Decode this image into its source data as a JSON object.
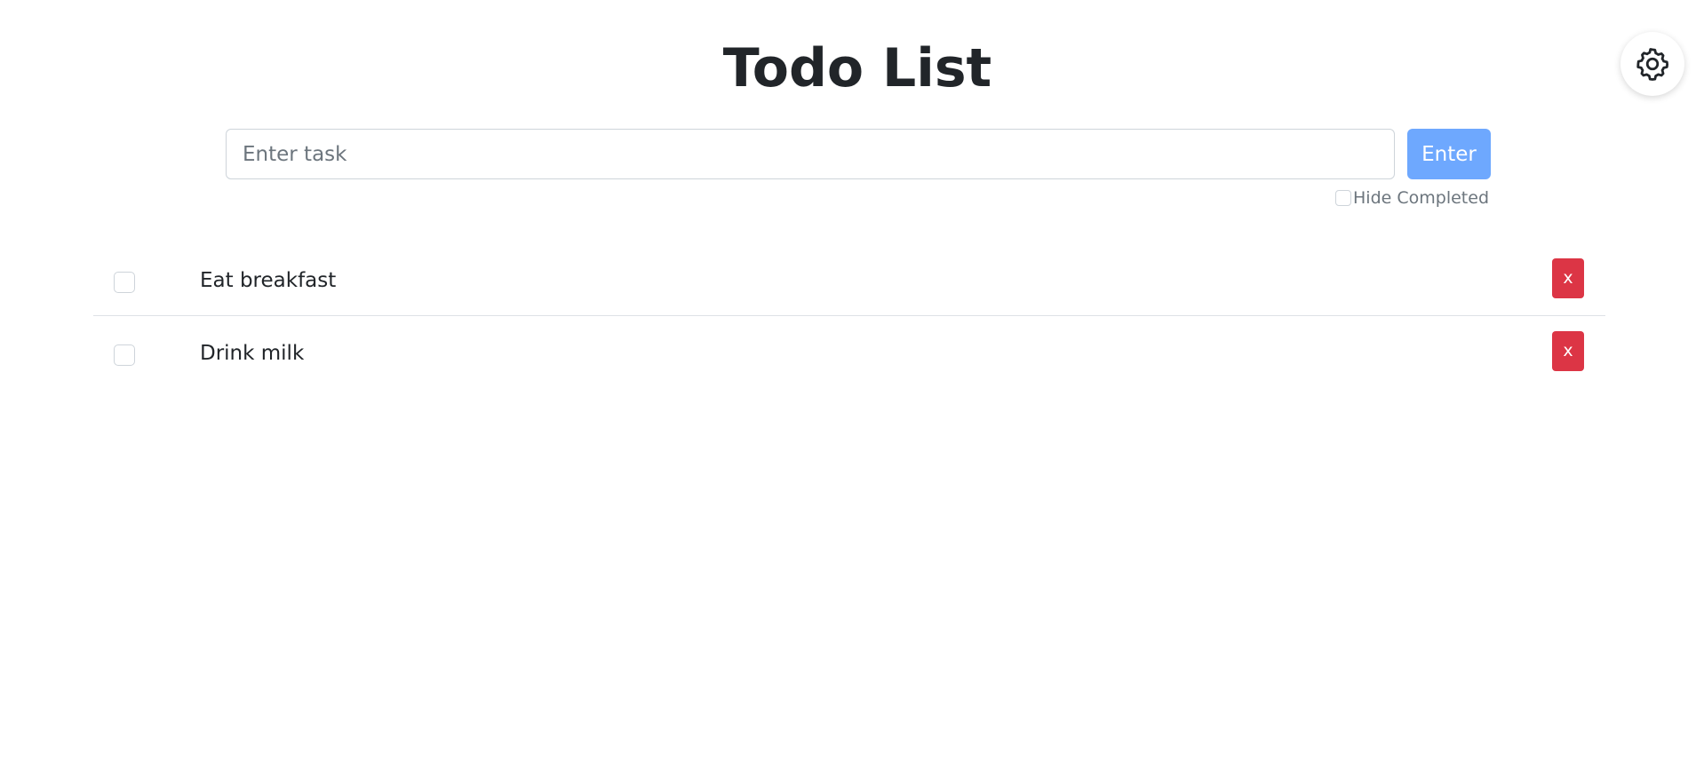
{
  "header": {
    "title": "Todo List",
    "settings_icon": "gear-icon"
  },
  "form": {
    "input_value": "",
    "input_placeholder": "Enter task",
    "submit_label": "Enter",
    "hide_completed_label": "Hide Completed",
    "hide_completed_checked": false
  },
  "todos": [
    {
      "text": "Eat breakfast",
      "completed": false,
      "delete_label": "x"
    },
    {
      "text": "Drink milk",
      "completed": false,
      "delete_label": "x"
    }
  ],
  "colors": {
    "primary_button": "#6ea8fe",
    "delete_button": "#dc3545",
    "text": "#212529",
    "muted": "#6c757d"
  }
}
